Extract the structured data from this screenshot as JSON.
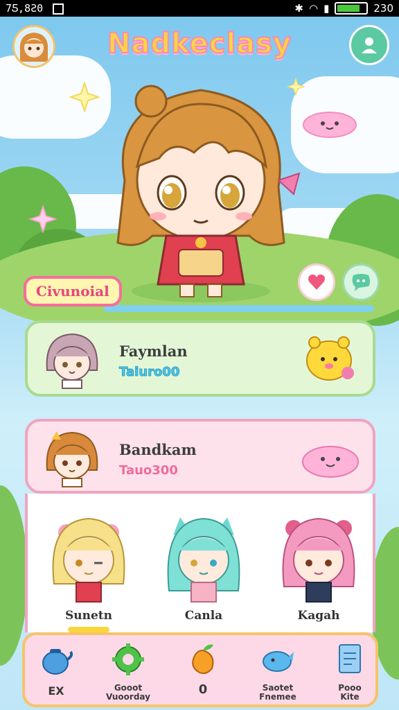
{
  "status_bar": {
    "time": "7Ƽ,8Ƨ0",
    "right_time": "230",
    "battery_level": 0.85
  },
  "app": {
    "title": "Nadkeclasy"
  },
  "hero": {
    "label": "Civunoial"
  },
  "cards": [
    {
      "name": "Faymlan",
      "sub": "Taiuro00"
    },
    {
      "name": "Bandkam",
      "sub": "Tauo300"
    }
  ],
  "team": [
    {
      "name": "Sunetn"
    },
    {
      "name": "Canla"
    },
    {
      "name": "Kagah"
    }
  ],
  "dock": {
    "items": [
      {
        "label": "EX"
      },
      {
        "label": "Gooot\nVuoorday"
      },
      {
        "label": "0"
      },
      {
        "label": "Saotet\nFnemee"
      },
      {
        "label": "Pooo\nKite"
      }
    ]
  },
  "colors": {
    "accent_pink": "#f66d9b",
    "accent_yellow": "#f7d547",
    "accent_teal": "#5bc9a1"
  },
  "icons": [
    "heart-icon",
    "chat-icon",
    "profile-icon",
    "sparkle-icon"
  ]
}
